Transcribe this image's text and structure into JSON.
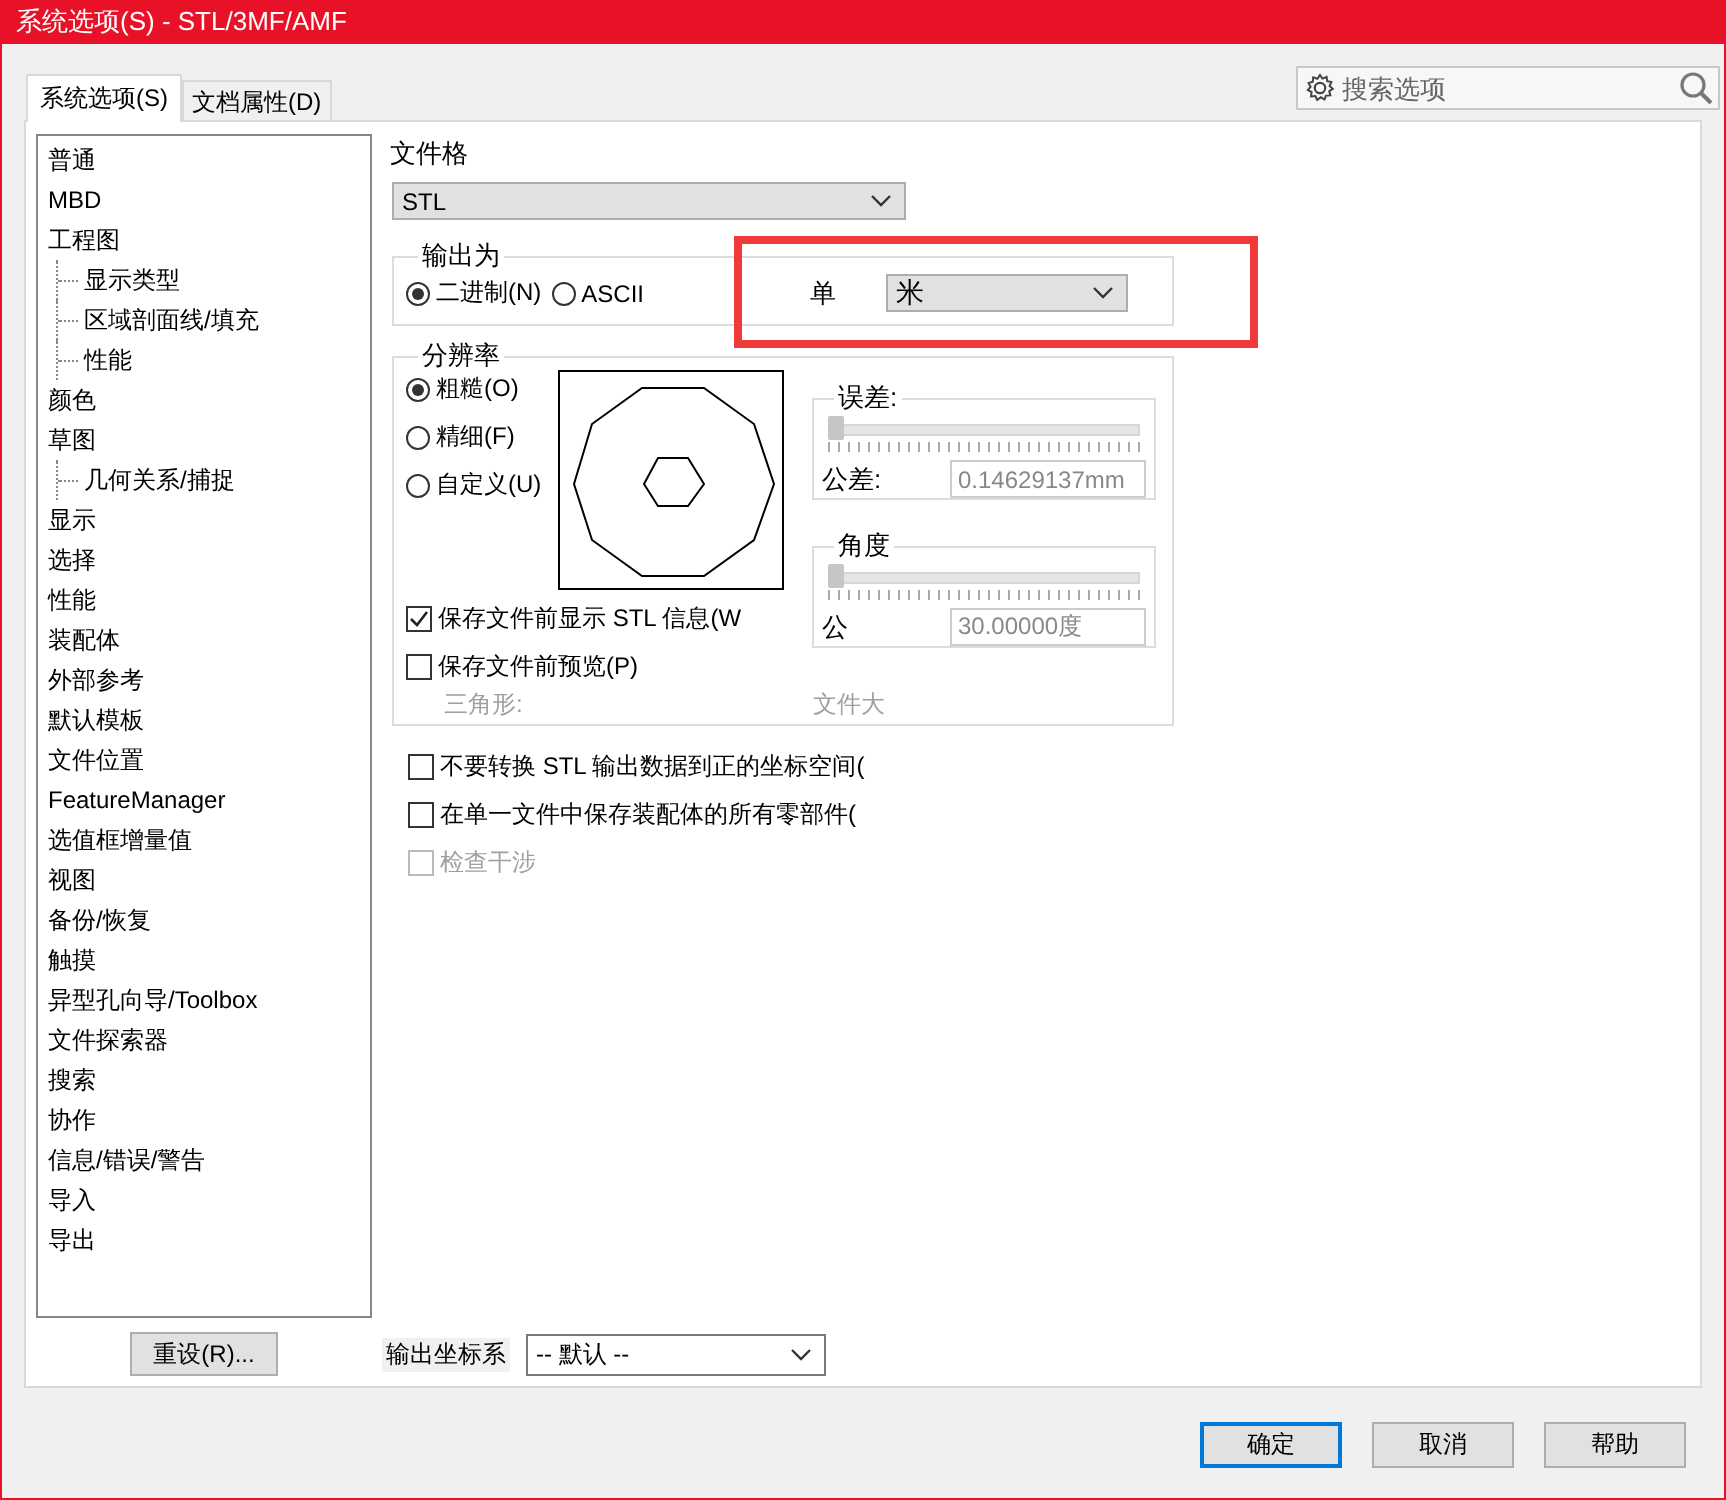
{
  "window": {
    "title": "系统选项(S) - STL/3MF/AMF"
  },
  "tabs": [
    {
      "label": "系统选项(S)",
      "selected": true
    },
    {
      "label": "文档属性(D)",
      "selected": false
    }
  ],
  "search": {
    "placeholder": "搜索选项"
  },
  "tree": [
    {
      "label": "普通"
    },
    {
      "label": "MBD"
    },
    {
      "label": "工程图",
      "children": [
        {
          "label": "显示类型"
        },
        {
          "label": "区域剖面线/填充"
        },
        {
          "label": "性能"
        }
      ]
    },
    {
      "label": "颜色"
    },
    {
      "label": "草图",
      "children": [
        {
          "label": "几何关系/捕捉"
        }
      ]
    },
    {
      "label": "显示"
    },
    {
      "label": "选择"
    },
    {
      "label": "性能"
    },
    {
      "label": "装配体"
    },
    {
      "label": "外部参考"
    },
    {
      "label": "默认模板"
    },
    {
      "label": "文件位置"
    },
    {
      "label": "FeatureManager"
    },
    {
      "label": "选值框增量值"
    },
    {
      "label": "视图"
    },
    {
      "label": "备份/恢复"
    },
    {
      "label": "触摸"
    },
    {
      "label": "异型孔向导/Toolbox"
    },
    {
      "label": "文件探索器"
    },
    {
      "label": "搜索"
    },
    {
      "label": "协作"
    },
    {
      "label": "信息/错误/警告"
    },
    {
      "label": "导入"
    },
    {
      "label": "导出"
    }
  ],
  "reset_button": "重设(R)...",
  "file_format": {
    "label": "文件格",
    "value": "STL"
  },
  "output_as": {
    "legend": "输出为",
    "options": [
      {
        "label": "二进制(N)",
        "selected": true
      },
      {
        "label": "ASCII",
        "selected": false
      }
    ]
  },
  "unit": {
    "label": "单",
    "value": "米"
  },
  "resolution": {
    "legend": "分辨率",
    "options": [
      {
        "label": "粗糙(O)",
        "selected": true
      },
      {
        "label": "精细(F)",
        "selected": false
      },
      {
        "label": "自定义(U)",
        "selected": false
      }
    ],
    "deviation": {
      "legend": "误差:",
      "level": 0,
      "label": "公差:",
      "value": "0.14629137mm",
      "disabled": true
    },
    "angle": {
      "legend": "角度",
      "level": 0,
      "label": "公",
      "value": "30.00000度",
      "disabled": true
    },
    "checkboxes": [
      {
        "label": "保存文件前显示 STL 信息(W",
        "checked": true
      },
      {
        "label": "保存文件前预览(P)",
        "checked": false
      }
    ],
    "triangles_label": "三角形:",
    "file_size_label": "文件大"
  },
  "options": [
    {
      "label": "不要转换 STL 输出数据到正的坐标空间(",
      "checked": false,
      "disabled": false
    },
    {
      "label": "在单一文件中保存装配体的所有零部件(",
      "checked": false,
      "disabled": false
    },
    {
      "label": "检查干涉",
      "checked": false,
      "disabled": true
    }
  ],
  "coordinate_system": {
    "label": "输出坐标系",
    "value": "-- 默认 --"
  },
  "buttons": [
    {
      "label": "确定",
      "default": true
    },
    {
      "label": "取消",
      "default": false
    },
    {
      "label": "帮助",
      "default": false
    }
  ]
}
